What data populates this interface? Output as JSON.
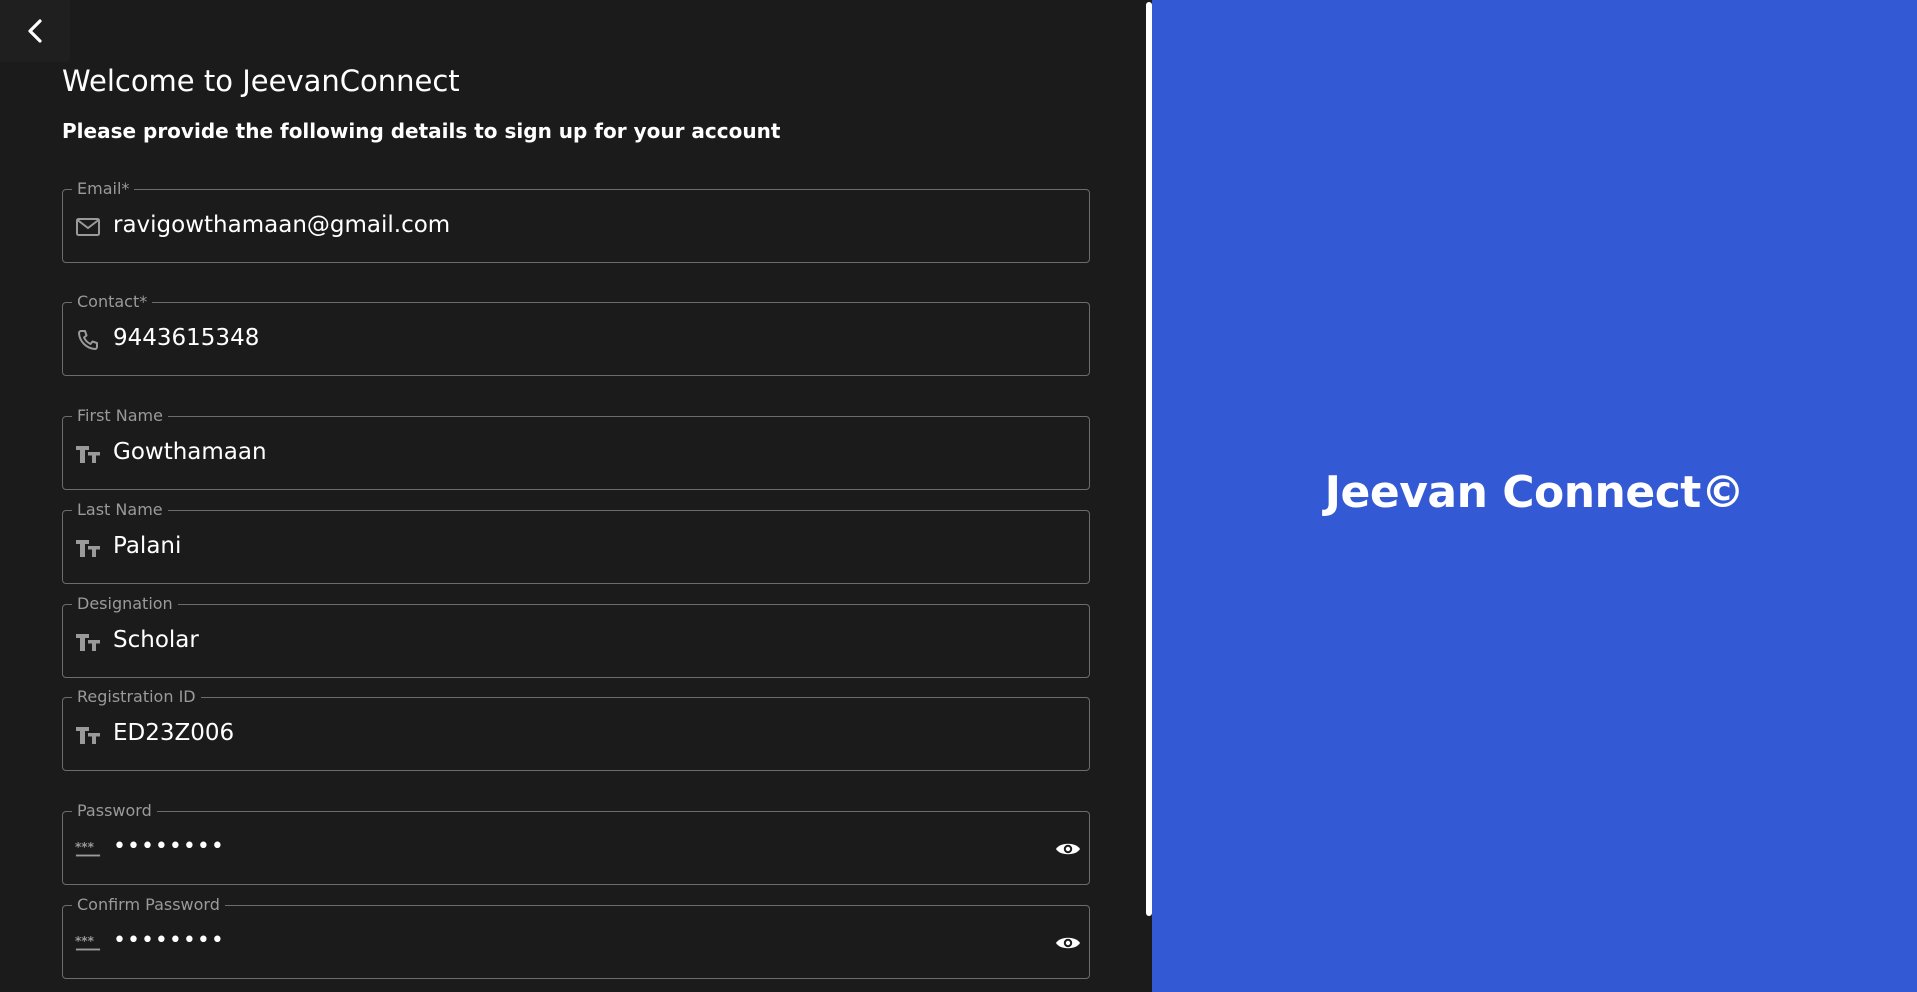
{
  "header": {
    "title": "Welcome to JeevanConnect",
    "subtitle": "Please provide the following details to sign up for your account"
  },
  "form": {
    "email": {
      "label": "Email*",
      "value": "ravigowthamaan@gmail.com",
      "icon": "mail-icon"
    },
    "contact": {
      "label": "Contact*",
      "value": "9443615348",
      "icon": "phone-icon"
    },
    "first_name": {
      "label": "First Name",
      "value": "Gowthamaan",
      "icon": "text-fields-icon"
    },
    "last_name": {
      "label": "Last Name",
      "value": "Palani",
      "icon": "text-fields-icon"
    },
    "designation": {
      "label": "Designation",
      "value": "Scholar",
      "icon": "text-fields-icon"
    },
    "registration_id": {
      "label": "Registration ID",
      "value": "ED23Z006",
      "icon": "text-fields-icon"
    },
    "password": {
      "label": "Password",
      "value": "••••••••",
      "icon": "password-icon"
    },
    "confirm_password": {
      "label": "Confirm Password",
      "value": "••••••••",
      "icon": "password-icon"
    }
  },
  "brand": {
    "name": "Jeevan Connect©",
    "background_color": "#335ad4"
  },
  "theme": {
    "page_background": "#1b1b1b",
    "field_border": "#6c6c6c",
    "label_color": "#9a9a9a"
  }
}
